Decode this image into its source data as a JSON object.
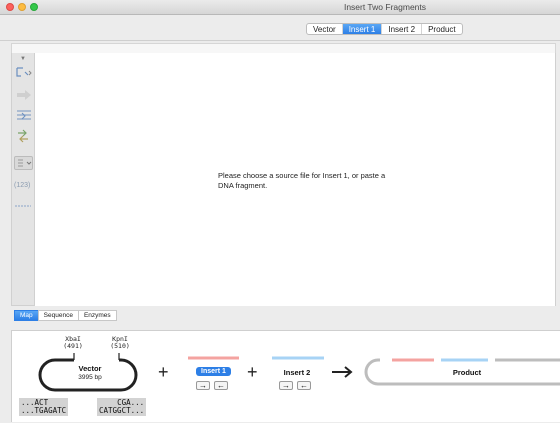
{
  "window": {
    "title": "Insert Two Fragments"
  },
  "toolbar": {
    "segments": [
      "Vector",
      "Insert 1",
      "Insert 2",
      "Product"
    ],
    "active": "Insert 1"
  },
  "main": {
    "placeholder": "Please choose a source file for Insert 1, or paste a DNA fragment."
  },
  "sidebar": {
    "counter_label": "(123)"
  },
  "view_tabs": [
    "Map",
    "Sequence",
    "Enzymes"
  ],
  "diagram": {
    "vector": {
      "name": "Vector",
      "size": "3995 bp"
    },
    "sites": [
      {
        "name": "XbaI",
        "position": "(491)"
      },
      {
        "name": "KpnI",
        "position": "(510)"
      }
    ],
    "insert1_label": "Insert 1",
    "insert2_label": "Insert 2",
    "product_label": "Product",
    "plus": "+",
    "arrow": "➔",
    "forward": "→",
    "reverse": "←",
    "left_seq": {
      "top": "...ACT",
      "bottom": "...TGAGATC"
    },
    "right_seq": {
      "top": "CGA...",
      "bottom": "CATGGCT..."
    }
  },
  "colors": {
    "accent": "#2d7fe6",
    "insert1_bar": "#f4a3a0",
    "insert2_bar": "#a7d3f5",
    "product_bar": "#bdbdbd"
  }
}
